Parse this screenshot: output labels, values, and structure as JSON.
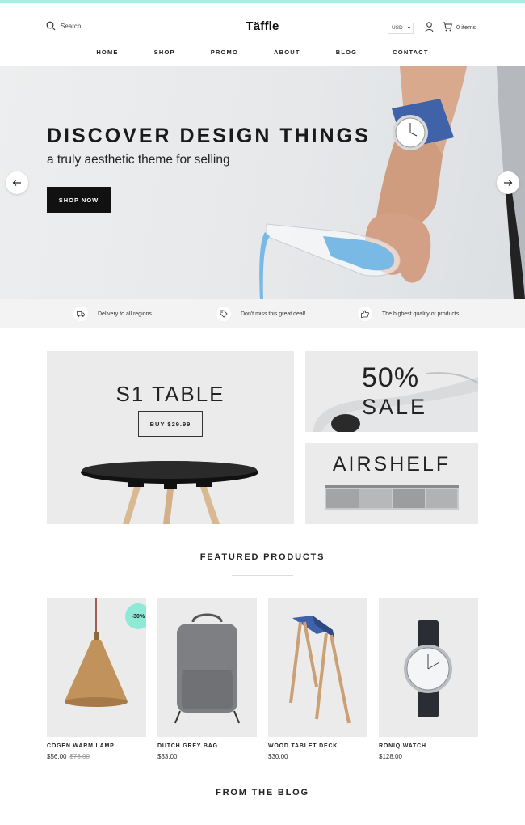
{
  "header": {
    "search_label": "Search",
    "logo": "Täffle",
    "currency": "USD",
    "cart_label": "0 items"
  },
  "nav": [
    "HOME",
    "SHOP",
    "PROMO",
    "ABOUT",
    "BLOG",
    "CONTACT"
  ],
  "hero": {
    "title": "DISCOVER DESIGN THINGS",
    "subtitle": "a truly aesthetic theme for selling",
    "button": "SHOP NOW"
  },
  "features": [
    {
      "icon": "truck-icon",
      "text": "Delivery to all regions"
    },
    {
      "icon": "tag-icon",
      "text": "Don't miss this great deal!"
    },
    {
      "icon": "thumbs-up-icon",
      "text": "The highest quality of products"
    }
  ],
  "promos": {
    "s1_title": "S1 TABLE",
    "s1_button": "BUY $29.99",
    "sale_percent": "50%",
    "sale_word": "SALE",
    "airshelf_title": "AIRSHELF"
  },
  "featured": {
    "title": "FEATURED PRODUCTS",
    "products": [
      {
        "name": "COGEN WARM LAMP",
        "price": "$56.00",
        "old_price": "$73.00",
        "badge": "-30%"
      },
      {
        "name": "DUTCH GREY BAG",
        "price": "$33.00"
      },
      {
        "name": "WOOD TABLET DECK",
        "price": "$30.00"
      },
      {
        "name": "RONIQ WATCH",
        "price": "$128.00"
      }
    ]
  },
  "blog": {
    "title": "FROM THE BLOG"
  },
  "colors": {
    "accent": "#8ee9d7",
    "topline": "#a8efe0",
    "button": "#111111"
  }
}
